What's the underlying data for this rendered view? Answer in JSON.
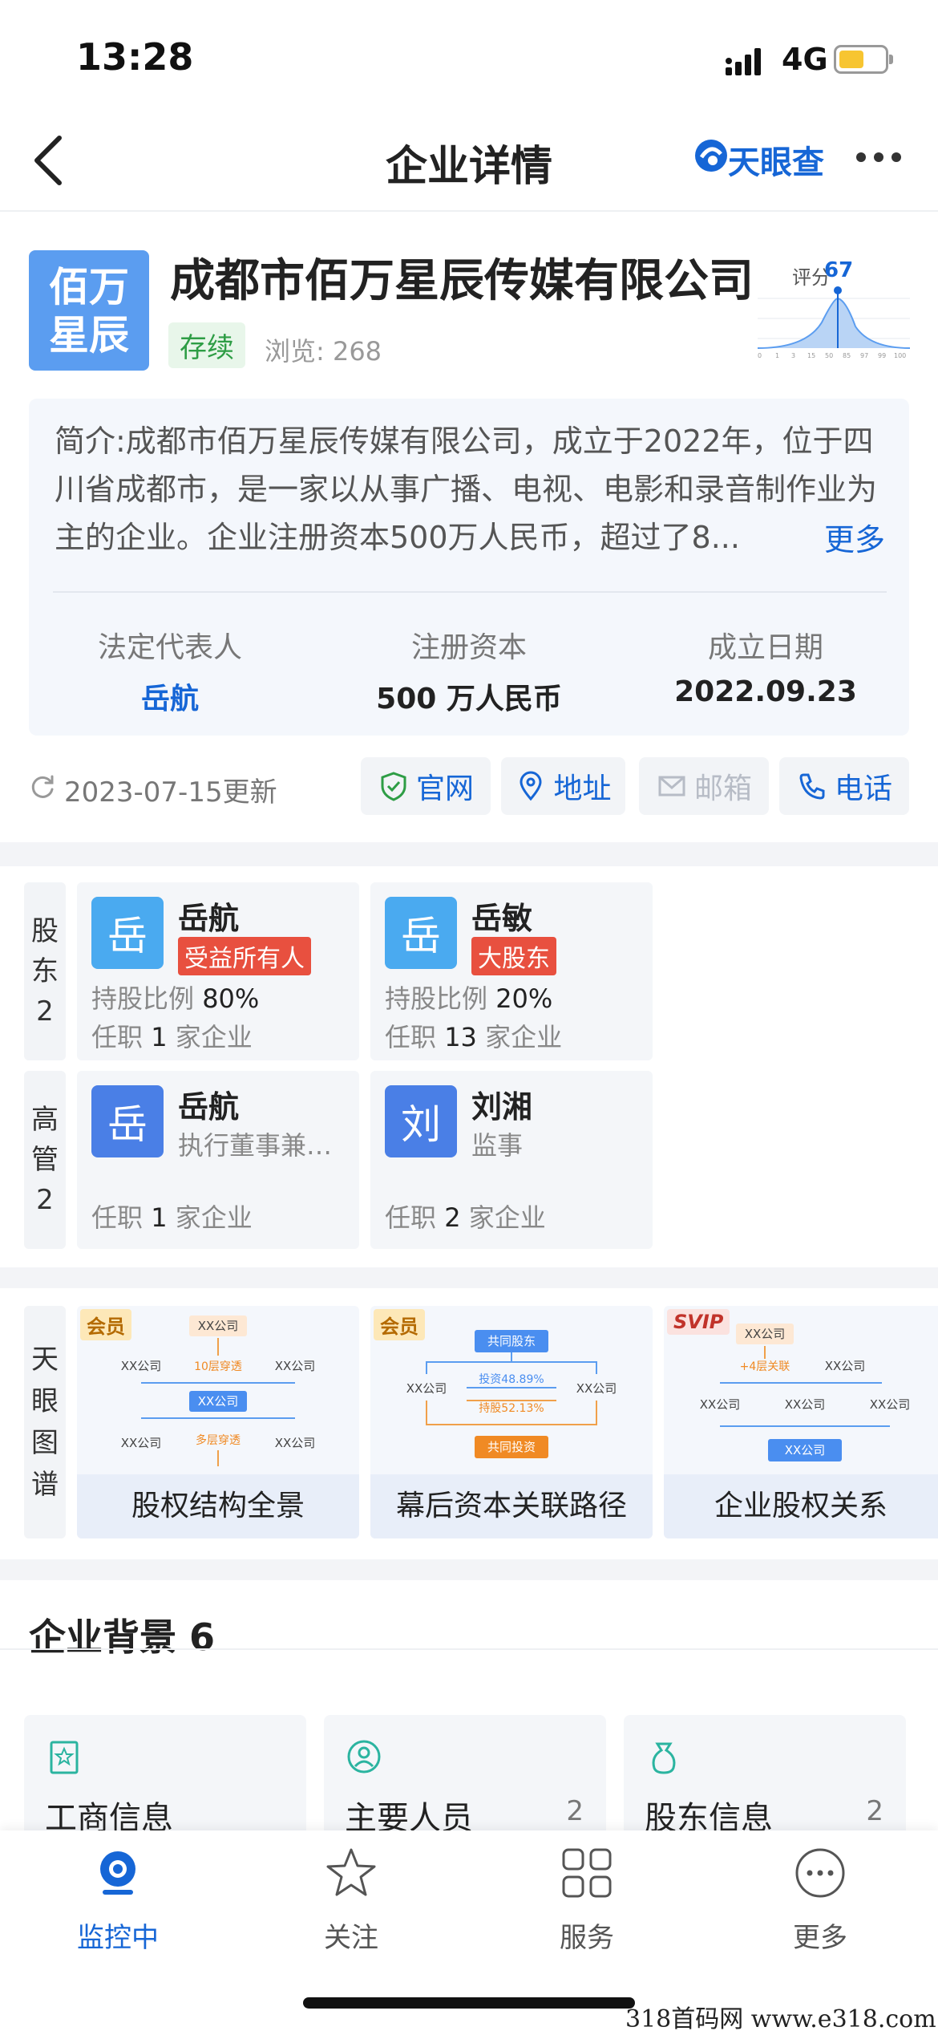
{
  "status": {
    "time": "13:28",
    "network": "4G"
  },
  "nav": {
    "title": "企业详情",
    "brand": "天眼查"
  },
  "company": {
    "logo_line1": "佰万",
    "logo_line2": "星辰",
    "name": "成都市佰万星辰传媒有限公司",
    "status": "存续",
    "views": "浏览: 268",
    "score_label": "评分",
    "score": "67",
    "score_axis": [
      "0",
      "1",
      "3",
      "15",
      "50",
      "85",
      "97",
      "99",
      "100"
    ]
  },
  "intro": {
    "text": "简介:成都市佰万星辰传媒有限公司，成立于2022年，位于四川省成都市，是一家以从事广播、电视、电影和录音制作业为主的企业。企业注册资本500万人民币，超过了8...",
    "more": "更多"
  },
  "key_info": [
    {
      "label": "法定代表人",
      "value": "岳航"
    },
    {
      "label": "注册资本",
      "value": "500 万人民币"
    },
    {
      "label": "成立日期",
      "value": "2022.09.23"
    }
  ],
  "update": {
    "text": "2023-07-15更新",
    "chips": [
      {
        "label": "官网",
        "icon": "shield-check-icon",
        "color": "#1666d6"
      },
      {
        "label": "地址",
        "icon": "location-pin-icon",
        "color": "#1666d6"
      },
      {
        "label": "邮箱",
        "icon": "mail-icon",
        "color": "#b7bcc6"
      },
      {
        "label": "电话",
        "icon": "phone-icon",
        "color": "#1666d6"
      }
    ]
  },
  "shareholders": {
    "label_chars": [
      "股",
      "东",
      "2"
    ],
    "items": [
      {
        "avatar": "岳",
        "name": "岳航",
        "tag": "受益所有人",
        "line1_label": "持股比例 ",
        "line1_value": "80%",
        "line2_a": "任职 ",
        "line2_b": "1",
        "line2_c": " 家企业"
      },
      {
        "avatar": "岳",
        "name": "岳敏",
        "tag": "大股东",
        "line1_label": "持股比例 ",
        "line1_value": "20%",
        "line2_a": "任职 ",
        "line2_b": "13",
        "line2_c": " 家企业"
      }
    ]
  },
  "executives": {
    "label_chars": [
      "高",
      "管",
      "2"
    ],
    "items": [
      {
        "avatar": "岳",
        "name": "岳航",
        "role": "执行董事兼…",
        "line_a": "任职 ",
        "line_b": "1",
        "line_c": " 家企业"
      },
      {
        "avatar": "刘",
        "name": "刘湘",
        "role": "监事",
        "line_a": "任职 ",
        "line_b": "2",
        "line_c": " 家企业"
      }
    ]
  },
  "graph": {
    "label_chars": [
      "天",
      "眼",
      "图",
      "谱"
    ],
    "cards": [
      {
        "badge": "会员",
        "caption": "股权结构全景",
        "n1": "XX公司",
        "n2": "XX公司",
        "n3": "XX公司",
        "n4": "10层穿透",
        "n5": "XX公司",
        "n6": "XX公司",
        "n7": "多层穿透",
        "n8": "XX公司"
      },
      {
        "badge": "会员",
        "caption": "幕后资本关联路径",
        "n1": "共同股东",
        "n2": "XX公司",
        "n3": "XX公司",
        "n4": "投资48.89%",
        "n5": "持股52.13%",
        "n6": "共同投资"
      },
      {
        "badge": "SVIP",
        "caption": "企业股权关系",
        "n1": "XX公司",
        "n2": "+4层关联",
        "n3": "XX公司",
        "n4": "XX公司",
        "n5": "XX公司",
        "n6": "XX公司",
        "n7": "XX公司"
      }
    ]
  },
  "background": {
    "title": "企业背景 6",
    "cards": [
      {
        "label": "工商信息",
        "count": ""
      },
      {
        "label": "主要人员",
        "count": "2"
      },
      {
        "label": "股东信息",
        "count": "2"
      }
    ]
  },
  "tabs": [
    {
      "label": "监控中"
    },
    {
      "label": "关注"
    },
    {
      "label": "服务"
    },
    {
      "label": "更多"
    }
  ],
  "watermark": "318首码网  www.e318.com",
  "colors": {
    "accent": "#1666d6",
    "tag_red": "#e8503f",
    "status_green": "#2e9d45"
  }
}
